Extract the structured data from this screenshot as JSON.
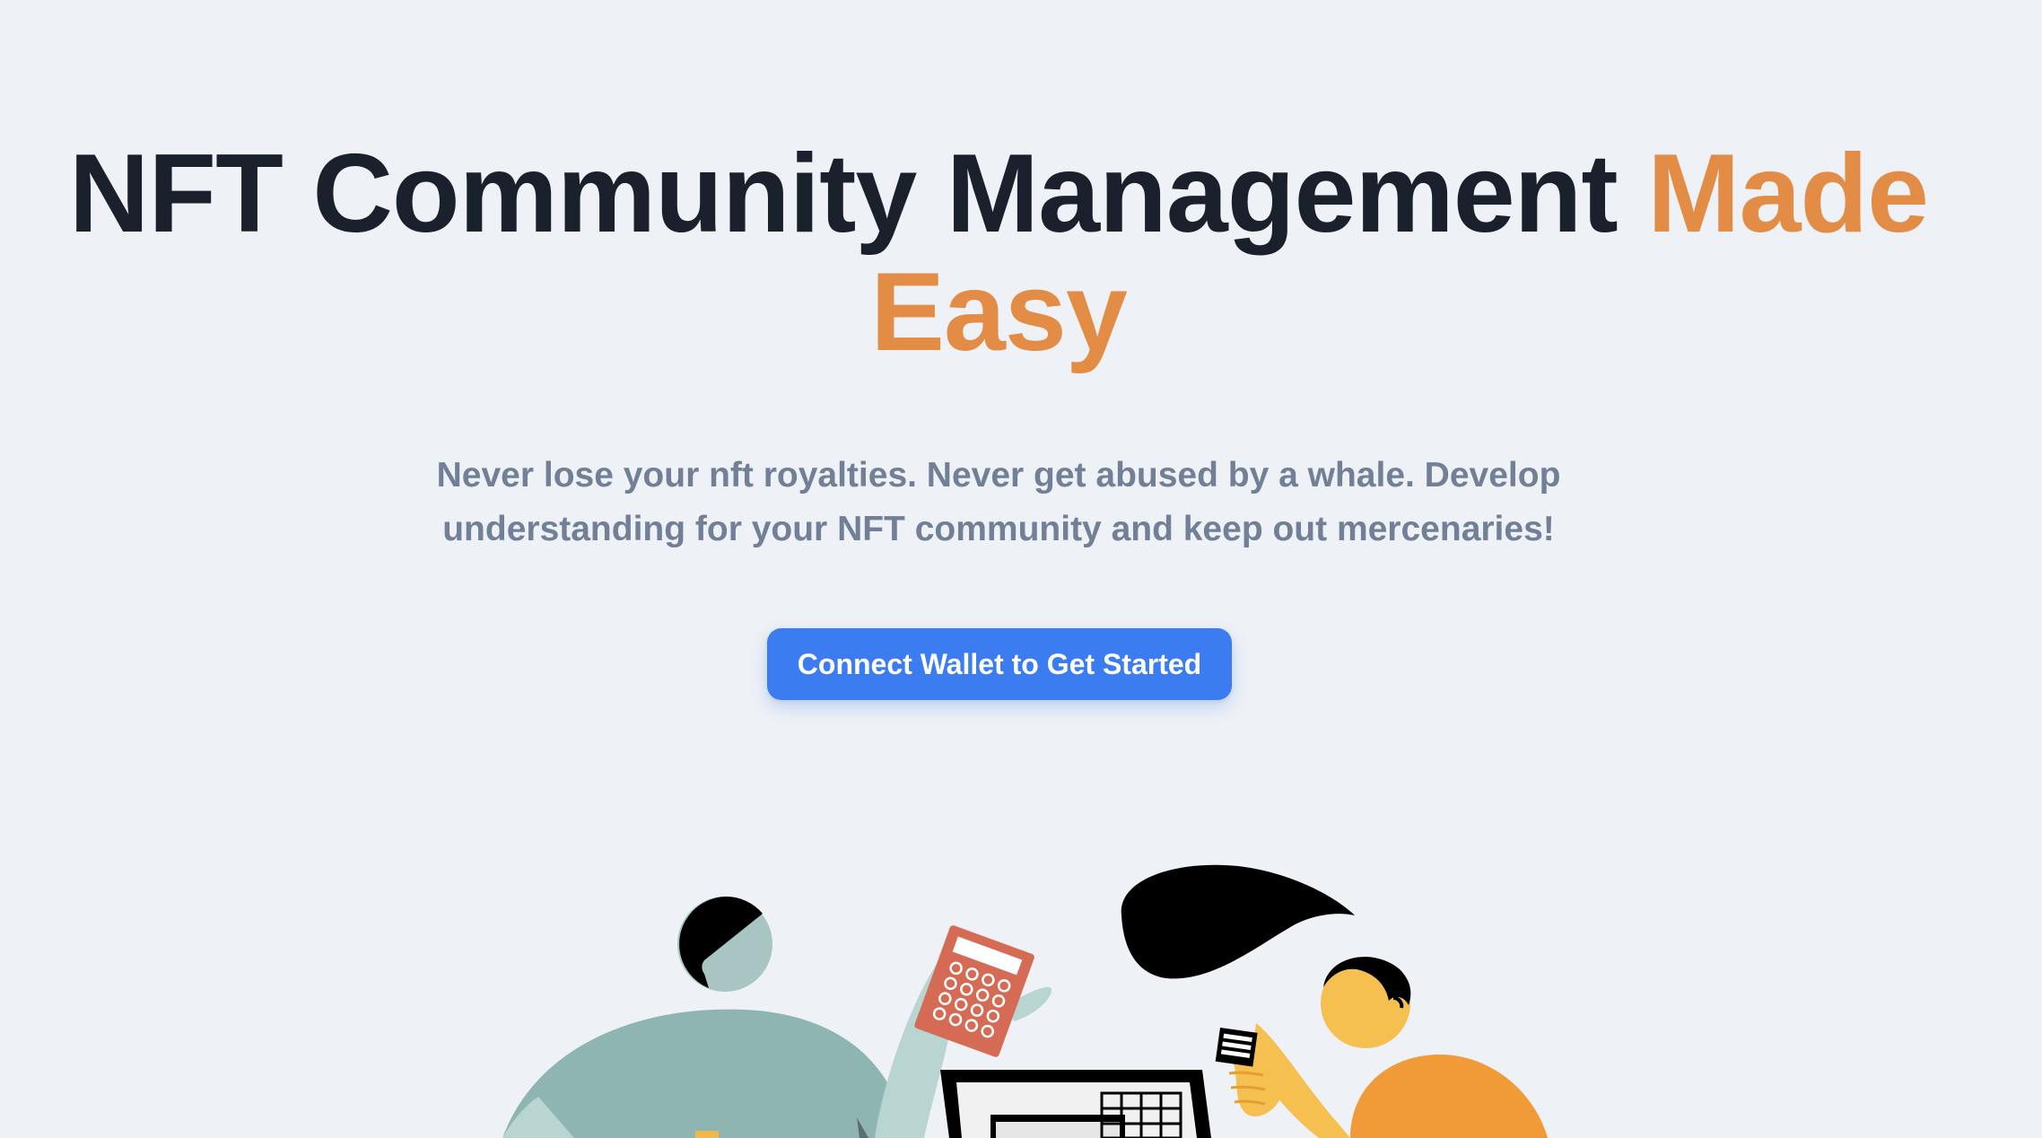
{
  "hero": {
    "title_main": "NFT Community Management ",
    "title_accent": "Made Easy",
    "subtitle": "Never lose your nft royalties. Never get abused by a whale. Develop understanding for your NFT community and keep out mercenaries!",
    "cta_label": "Connect Wallet to Get Started"
  },
  "colors": {
    "background": "#eef1f6",
    "title": "#1a202c",
    "accent": "#e38c45",
    "subtitle": "#718096",
    "button": "#3b7cf0"
  },
  "illustration": {
    "icons": [
      "person-icon",
      "calculator-icon",
      "speech-bubble-icon",
      "laptop-icon",
      "receipt-icon",
      "person-icon"
    ]
  }
}
